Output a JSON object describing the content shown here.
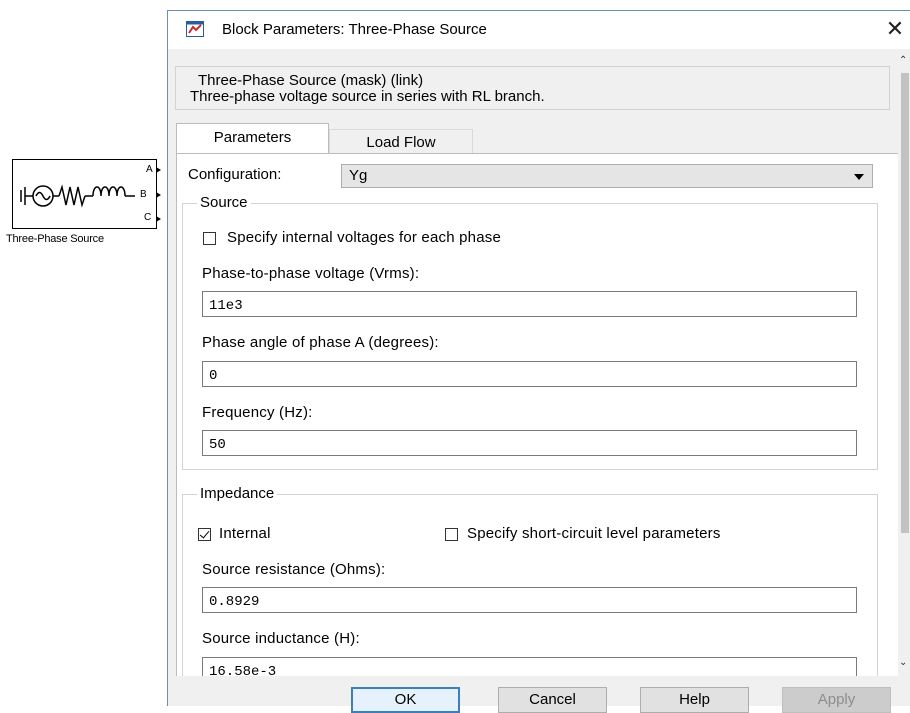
{
  "canvas": {
    "block_name": "Three-Phase Source",
    "ports": [
      "A",
      "B",
      "C"
    ]
  },
  "dialog": {
    "title": "Block Parameters: Three-Phase Source",
    "close_glyph": "✕",
    "mask_title": "Three-Phase Source (mask) (link)",
    "mask_description": "Three-phase voltage source in series with RL branch.",
    "tabs": [
      {
        "label": "Parameters",
        "active": true
      },
      {
        "label": "Load Flow",
        "active": false
      }
    ],
    "configuration": {
      "label": "Configuration:",
      "value": "Yg"
    },
    "source": {
      "title": "Source",
      "specify_internal": {
        "label": "Specify internal voltages for each phase",
        "checked": false
      },
      "fields": [
        {
          "label": "Phase-to-phase voltage (Vrms):",
          "value": "11e3"
        },
        {
          "label": "Phase angle of phase A (degrees):",
          "value": "0"
        },
        {
          "label": "Frequency (Hz):",
          "value": "50"
        }
      ]
    },
    "impedance": {
      "title": "Impedance",
      "internal": {
        "label": "Internal",
        "checked": true
      },
      "short_circuit": {
        "label": "Specify short-circuit level parameters",
        "checked": false
      },
      "fields": [
        {
          "label": "Source resistance (Ohms):",
          "value": "0.8929"
        },
        {
          "label": "Source inductance (H):",
          "value": "16.58e-3"
        }
      ]
    },
    "buttons": {
      "ok": "OK",
      "cancel": "Cancel",
      "help": "Help",
      "apply": "Apply"
    }
  }
}
